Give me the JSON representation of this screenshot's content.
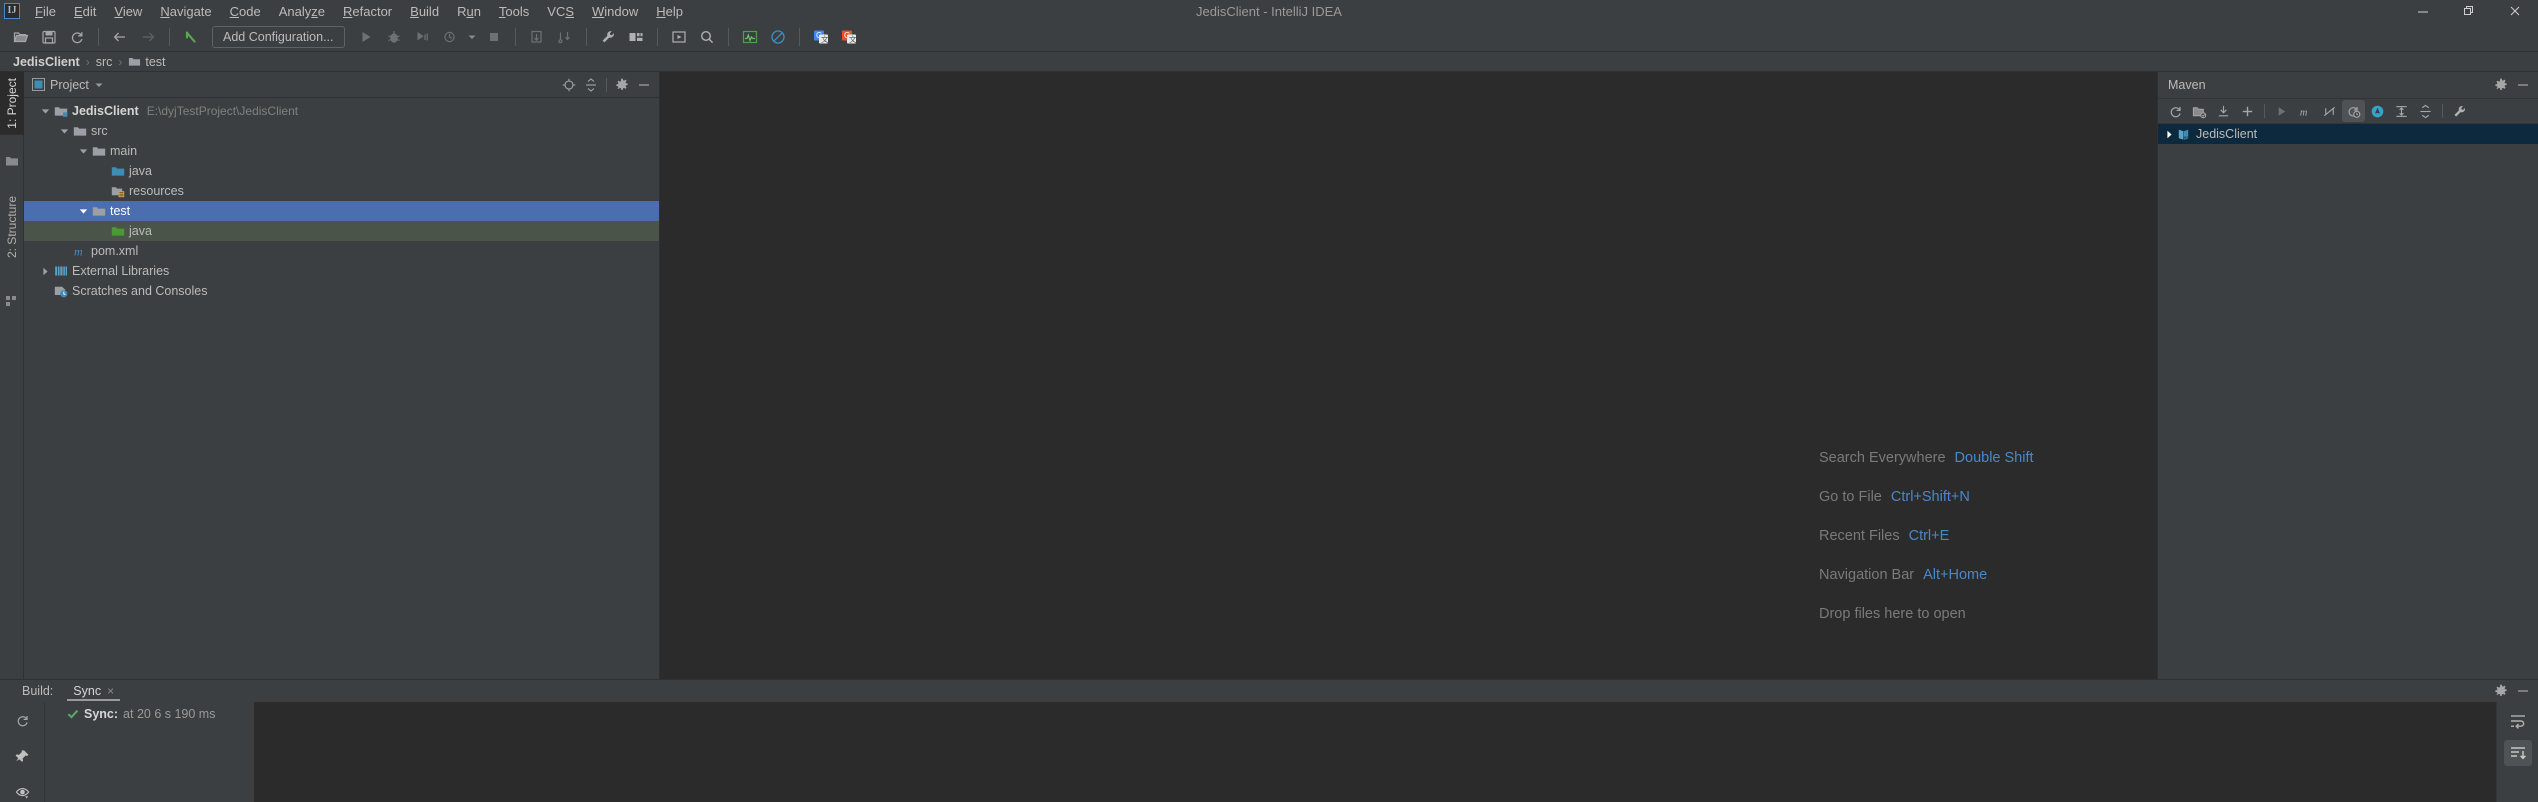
{
  "window": {
    "title": "JedisClient - IntelliJ IDEA",
    "logo_text": "IJ",
    "controls": {
      "minimize": "minimize-icon",
      "restore": "restore-icon",
      "close": "close-icon"
    }
  },
  "menu": {
    "items": [
      {
        "label": "File",
        "mnemonic": "F"
      },
      {
        "label": "Edit",
        "mnemonic": "E"
      },
      {
        "label": "View",
        "mnemonic": "V"
      },
      {
        "label": "Navigate",
        "mnemonic": "N"
      },
      {
        "label": "Code",
        "mnemonic": "C"
      },
      {
        "label": "Analyze",
        "mnemonic": "z"
      },
      {
        "label": "Refactor",
        "mnemonic": "R"
      },
      {
        "label": "Build",
        "mnemonic": "B"
      },
      {
        "label": "Run",
        "mnemonic": "u"
      },
      {
        "label": "Tools",
        "mnemonic": "T"
      },
      {
        "label": "VCS",
        "mnemonic": "S"
      },
      {
        "label": "Window",
        "mnemonic": "W"
      },
      {
        "label": "Help",
        "mnemonic": "H"
      }
    ]
  },
  "toolbar": {
    "open_label": "open-folder-icon",
    "save_label": "save-all-icon",
    "sync_label": "synchronize-icon",
    "back_label": "back-arrow-icon",
    "forward_label": "forward-arrow-icon",
    "search_back_label": "undo-icon",
    "run_config_text": "Add Configuration...",
    "run_label": "run-icon",
    "debug_label": "debug-icon",
    "run_coverage_label": "run-with-coverage-icon",
    "profile_label": "profile-icon",
    "stop_label": "stop-icon",
    "update_label": "update-project-icon",
    "commit_label": "commit-icon",
    "settings_label": "wrench-settings-icon",
    "structure_label": "project-structure-icon",
    "device_label": "device-manager-icon",
    "search_label": "search-everywhere-icon",
    "monitor_label": "profiler-monitor-icon",
    "disable_label": "no-entry-icon",
    "translate_label": "google-translate-icon",
    "translate_red_label": "google-translate-red-icon"
  },
  "breadcrumb": {
    "items": [
      {
        "label": "JedisClient",
        "bold": true,
        "icon": ""
      },
      {
        "label": "src",
        "bold": false,
        "icon": ""
      },
      {
        "label": "test",
        "bold": false,
        "icon": "folder-icon"
      }
    ],
    "separator": "›"
  },
  "left_strip": {
    "tabs": [
      {
        "label": "1: Project",
        "active": true
      },
      {
        "label": "2: Structure",
        "active": false
      }
    ],
    "icons": [
      "folder-icon",
      "structure-icon"
    ]
  },
  "project_panel": {
    "title": "Project",
    "view_caret": "chevron-down-icon",
    "buttons": [
      {
        "name": "locate-icon"
      },
      {
        "name": "collapse-all-icon"
      },
      {
        "name": "gear-icon"
      },
      {
        "name": "minimize-icon"
      }
    ],
    "tree": [
      {
        "label": "JedisClient",
        "path": "E:\\dyjTestProject\\JedisClient",
        "depth": 0,
        "twist": "down",
        "icon": "module-icon",
        "bold": true,
        "state": "none"
      },
      {
        "label": "src",
        "path": "",
        "depth": 1,
        "twist": "down",
        "icon": "folder-icon",
        "bold": false,
        "state": "none"
      },
      {
        "label": "main",
        "path": "",
        "depth": 2,
        "twist": "down",
        "icon": "folder-icon",
        "bold": false,
        "state": "none"
      },
      {
        "label": "java",
        "path": "",
        "depth": 3,
        "twist": "none",
        "icon": "source-root-icon",
        "bold": false,
        "state": "none"
      },
      {
        "label": "resources",
        "path": "",
        "depth": 3,
        "twist": "none",
        "icon": "resource-root-icon",
        "bold": false,
        "state": "none"
      },
      {
        "label": "test",
        "path": "",
        "depth": 2,
        "twist": "down",
        "icon": "folder-icon",
        "bold": false,
        "state": "selected"
      },
      {
        "label": "java",
        "path": "",
        "depth": 3,
        "twist": "none",
        "icon": "test-root-icon",
        "bold": false,
        "state": "tinted"
      },
      {
        "label": "pom.xml",
        "path": "",
        "depth": 1,
        "twist": "none",
        "icon": "maven-file-icon",
        "bold": false,
        "state": "none"
      },
      {
        "label": "External Libraries",
        "path": "",
        "depth": 0,
        "twist": "right",
        "icon": "libraries-icon",
        "bold": false,
        "state": "none"
      },
      {
        "label": "Scratches and Consoles",
        "path": "",
        "depth": 0,
        "twist": "none",
        "icon": "scratches-icon",
        "bold": false,
        "state": "none"
      }
    ]
  },
  "editor": {
    "tips": [
      {
        "label": "Search Everywhere",
        "key": "Double Shift"
      },
      {
        "label": "Go to File",
        "key": "Ctrl+Shift+N"
      },
      {
        "label": "Recent Files",
        "key": "Ctrl+E"
      },
      {
        "label": "Navigation Bar",
        "key": "Alt+Home"
      },
      {
        "label": "Drop files here to open",
        "key": ""
      }
    ]
  },
  "maven_panel": {
    "title": "Maven",
    "header_buttons": [
      {
        "name": "gear-icon"
      },
      {
        "name": "minimize-icon"
      }
    ],
    "toolbar": [
      {
        "name": "reload-all-projects-icon",
        "active": false
      },
      {
        "name": "generate-sources-icon",
        "active": false
      },
      {
        "name": "download-sources-icon",
        "active": false
      },
      {
        "name": "add-maven-project-icon",
        "active": false
      },
      {
        "name": "run-maven-build-icon",
        "active": false
      },
      {
        "name": "execute-maven-goal-icon",
        "active": false
      },
      {
        "name": "toggle-skip-tests-icon",
        "active": false
      },
      {
        "name": "toggle-offline-mode-icon",
        "active": true
      },
      {
        "name": "show-dependencies-icon",
        "active": false
      },
      {
        "name": "expand-all-icon",
        "active": false
      },
      {
        "name": "collapse-all-icon",
        "active": false
      },
      {
        "name": "maven-settings-icon",
        "active": false
      }
    ],
    "tree": [
      {
        "label": "JedisClient",
        "twist": "right",
        "icon": "maven-project-icon",
        "selected": true
      }
    ]
  },
  "build_panel": {
    "label": "Build:",
    "tab": {
      "label": "Sync",
      "close": "×"
    },
    "header_buttons": [
      {
        "name": "gear-icon"
      },
      {
        "name": "minimize-icon"
      }
    ],
    "side_buttons": [
      {
        "name": "rerun-icon"
      },
      {
        "name": "pin-tab-icon"
      },
      {
        "name": "show-warnings-icon"
      }
    ],
    "tree_rows": [
      {
        "status": "success",
        "name": "Sync:",
        "detail": "at 20 6 s 190 ms"
      }
    ],
    "output_buttons": [
      {
        "name": "soft-wrap-icon",
        "active": false
      },
      {
        "name": "scroll-to-end-icon",
        "active": true
      }
    ]
  },
  "colors": {
    "chrome": "#3c3f41",
    "editor_bg": "#2b2b2b",
    "selection_blue": "#4b6eaf",
    "test_tint_green": "#4a5449",
    "maven_row_blue": "#0d293e",
    "link_blue": "#4a88c7",
    "text": "#bbbbbb",
    "muted_text": "#808080",
    "source_blue": "#3f8cb5",
    "test_green": "#4a9a33",
    "success_green": "#59a869"
  }
}
